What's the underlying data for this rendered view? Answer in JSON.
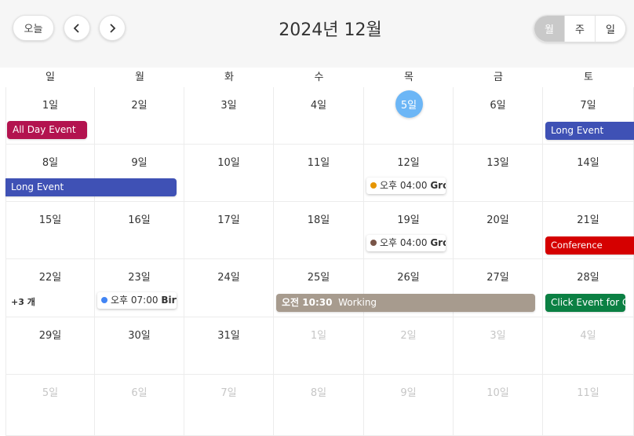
{
  "toolbar": {
    "today_label": "오늘",
    "title": "2024년 12월",
    "views": [
      "월",
      "주",
      "일"
    ],
    "active_view": "월"
  },
  "weekdays": [
    "일",
    "월",
    "화",
    "수",
    "목",
    "금",
    "토"
  ],
  "weeks": [
    [
      "1일",
      "2일",
      "3일",
      "4일",
      "5일",
      "6일",
      "7일"
    ],
    [
      "8일",
      "9일",
      "10일",
      "11일",
      "12일",
      "13일",
      "14일"
    ],
    [
      "15일",
      "16일",
      "17일",
      "18일",
      "19일",
      "20일",
      "21일"
    ],
    [
      "22일",
      "23일",
      "24일",
      "25일",
      "26일",
      "27일",
      "28일"
    ],
    [
      "29일",
      "30일",
      "31일",
      "1일",
      "2일",
      "3일",
      "4일"
    ],
    [
      "5일",
      "6일",
      "7일",
      "8일",
      "9일",
      "10일",
      "11일"
    ]
  ],
  "today": "5일",
  "events": {
    "all_day": "All Day Event",
    "long_1": "Long Event",
    "long_2": "Long Event",
    "group_1": {
      "time": "오후 04:00",
      "title": "Group Meeting"
    },
    "group_2": {
      "time": "오후 04:00",
      "title": "Group Meeting"
    },
    "conference": "Conference",
    "more": "+3 개",
    "birthday": {
      "time": "오후 07:00",
      "title": "Birthday Party"
    },
    "working": {
      "time": "오전 10:30",
      "title": "Working"
    },
    "click_event": "Click Event for Google"
  },
  "colors": {
    "all_day": "#b3134f",
    "long": "#3f51b5",
    "group_1_dot": "#e69500",
    "group_2_dot": "#795548",
    "conference": "#d50000",
    "birthday_dot": "#4285f4",
    "working": "#a79b8e",
    "click_event": "#0b8043",
    "today_circle": "#6cb6f6"
  }
}
